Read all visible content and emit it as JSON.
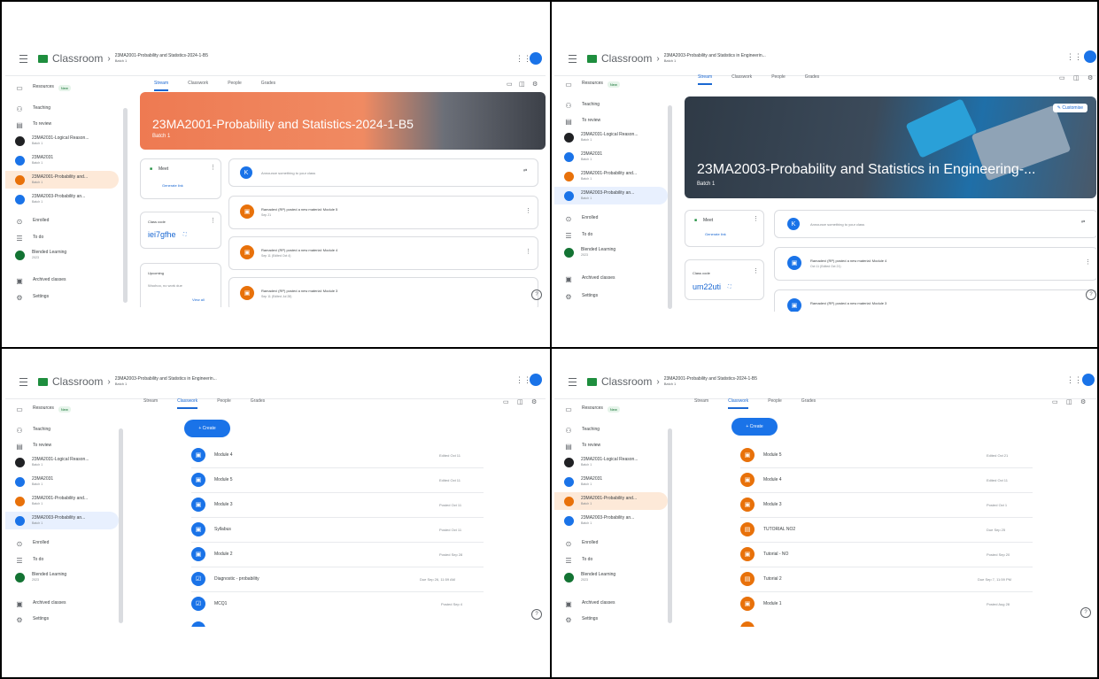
{
  "colors": {
    "accent": "#1a73e8",
    "orange": "#e8710a",
    "classroom_green": "#1e8e3e",
    "dark": "#202124"
  },
  "common": {
    "app_name": "Classroom",
    "new_badge": "New",
    "sidebar": [
      "Resources",
      "Teaching",
      "To review",
      "Enrolled",
      "To do",
      "Archived classes",
      "Settings"
    ],
    "tabs": [
      "Stream",
      "Classwork",
      "People",
      "Grades"
    ]
  },
  "panels": [
    {
      "id": "p1",
      "crumb_title": "23MA2001-Probability and Statistics-2024-1-B5",
      "crumb_sub": "Batch 1",
      "classes": [
        {
          "name": "23MA2031-Logical Reason...",
          "sub": "Batch 1",
          "color": "#202124"
        },
        {
          "name": "23MA2031",
          "sub": "Batch 1",
          "color": "#1a73e8"
        },
        {
          "name": "23MA2001-Probability and...",
          "sub": "Batch 1",
          "color": "#e8710a"
        },
        {
          "name": "23MA2003-Probability an...",
          "sub": "Batch 1",
          "color": "#1a73e8"
        }
      ],
      "banner_title": "23MA2001-Probability and Statistics-2024-1-B5",
      "banner_sub": "Batch 1",
      "meet_label": "Meet",
      "generate_link": "Generate link",
      "class_code_label": "Class code",
      "class_code": "iei7gfhe",
      "upcoming_label": "Upcoming",
      "upcoming_text": "Woohoo, no work due",
      "view_all": "View all",
      "announce_placeholder": "Announce something to your class",
      "posts": [
        {
          "title": "Ramadevi (RP) posted a new material: Module 5",
          "date": "Sep 21"
        },
        {
          "title": "Ramadevi (RP) posted a new material: Module 4",
          "date": "Sep 11 (Edited Oct 4)"
        },
        {
          "title": "Ramadevi (RP) posted a new material: Module 3",
          "date": "Sep 11 (Edited Jul 28)"
        }
      ]
    },
    {
      "id": "p2",
      "crumb_title": "23MA2003-Probability and Statistics in Engineerin...",
      "crumb_sub": "Batch 1",
      "classes": [
        {
          "name": "23MA2031-Logical Reason...",
          "sub": "Batch 1",
          "color": "#202124"
        },
        {
          "name": "23MA2031",
          "sub": "Batch 1",
          "color": "#1a73e8"
        },
        {
          "name": "23MA2001-Probability and...",
          "sub": "Batch 1",
          "color": "#e8710a"
        },
        {
          "name": "23MA2003-Probability an...",
          "sub": "Batch 1",
          "color": "#1a73e8"
        }
      ],
      "enrolled_class": {
        "name": "Blended Learning",
        "sub": "2023",
        "color": "#137333"
      },
      "banner_title": "23MA2003-Probability and Statistics in Engineering-...",
      "banner_sub": "Batch 1",
      "customise": "Customise",
      "meet_label": "Meet",
      "generate_link": "Generate link",
      "class_code_label": "Class code",
      "class_code": "um22uti",
      "announce_placeholder": "Announce something to your class",
      "posts": [
        {
          "title": "Ramadevi (RP) posted a new material: Module 4",
          "date": "Oct 11 (Edited Oct 21)"
        },
        {
          "title": "Ramadevi (RP) posted a new material: Module 3",
          "date": ""
        }
      ]
    },
    {
      "id": "p3",
      "crumb_title": "23MA2003-Probability and Statistics in Engineerin...",
      "crumb_sub": "Batch 1",
      "classes": [
        {
          "name": "23MA2031-Logical Reason...",
          "sub": "Batch 1",
          "color": "#202124"
        },
        {
          "name": "23MA2031",
          "sub": "Batch 1",
          "color": "#1a73e8"
        },
        {
          "name": "23MA2001-Probability and...",
          "sub": "Batch 1",
          "color": "#e8710a"
        },
        {
          "name": "23MA2003-Probability an...",
          "sub": "Batch 1",
          "color": "#1a73e8"
        }
      ],
      "enrolled_class": {
        "name": "Blended Learning",
        "sub": "2023",
        "color": "#137333"
      },
      "create_label": "+ Create",
      "items": [
        {
          "name": "Module 4",
          "date": "Edited Oct 11"
        },
        {
          "name": "Module 5",
          "date": "Edited Oct 11"
        },
        {
          "name": "Module 3",
          "date": "Posted Oct 11"
        },
        {
          "name": "Syllabus",
          "date": "Posted Oct 11"
        },
        {
          "name": "Module 2",
          "date": "Posted Sep 28"
        },
        {
          "name": "Diagnostic - probability",
          "date": "Due Sep 26, 11:59 AM"
        },
        {
          "name": "MCQ1",
          "date": "Posted Sep 4"
        }
      ]
    },
    {
      "id": "p4",
      "crumb_title": "23MA2001-Probability and Statistics-2024-1-B5",
      "crumb_sub": "Batch 1",
      "classes": [
        {
          "name": "23MA2031-Logical Reason...",
          "sub": "Batch 1",
          "color": "#202124"
        },
        {
          "name": "23MA2031",
          "sub": "Batch 1",
          "color": "#1a73e8"
        },
        {
          "name": "23MA2001-Probability and...",
          "sub": "Batch 1",
          "color": "#e8710a"
        },
        {
          "name": "23MA2003-Probability an...",
          "sub": "Batch 1",
          "color": "#1a73e8"
        }
      ],
      "enrolled_class": {
        "name": "Blended Learning",
        "sub": "2023",
        "color": "#137333"
      },
      "create_label": "+ Create",
      "items": [
        {
          "name": "Module 5",
          "date": "Edited Oct 21"
        },
        {
          "name": "Module 4",
          "date": "Edited Oct 11"
        },
        {
          "name": "Module 3",
          "date": "Posted Oct 1"
        },
        {
          "name": "TUTORIAL NO2",
          "date": "Due Sep 25"
        },
        {
          "name": "Tutorial - NO",
          "date": "Posted Sep 20"
        },
        {
          "name": "Tutorial 2",
          "date": "Due Sep 7, 11:59 PM"
        },
        {
          "name": "Module 1",
          "date": "Posted Aug 28"
        }
      ]
    }
  ]
}
